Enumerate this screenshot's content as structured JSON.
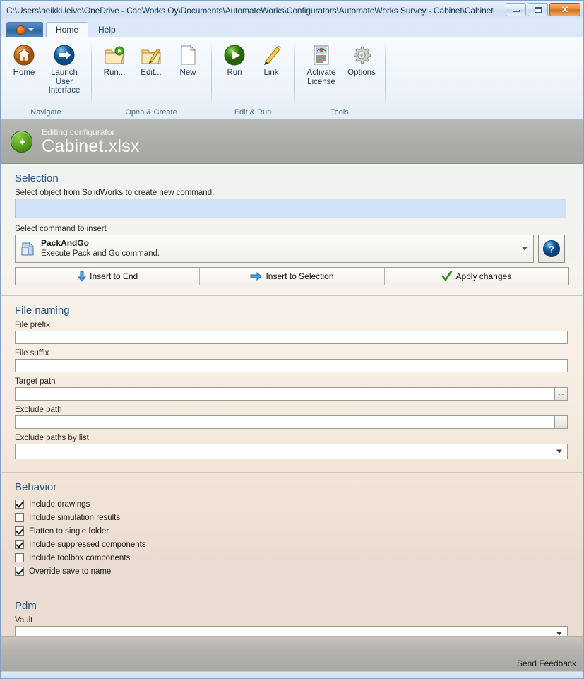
{
  "window": {
    "title": "C:\\Users\\heikki.leivo\\OneDrive - CadWorks Oy\\Documents\\AutomateWorks\\Configurators\\AutomateWorks Survey - Cabinet\\Cabinet.x",
    "minimize_label": "Minimize",
    "maximize_label": "Maximize",
    "close_label": "✕"
  },
  "tabs": [
    {
      "label": "Home",
      "active": true
    },
    {
      "label": "Help",
      "active": false
    }
  ],
  "ribbon": {
    "groups": [
      {
        "label": "Navigate",
        "items": [
          {
            "label": "Home",
            "icon": "home-circle-icon"
          },
          {
            "label": "Launch User Interface",
            "icon": "arrow-right-circle-icon"
          }
        ]
      },
      {
        "label": "Open & Create",
        "items": [
          {
            "label": "Run...",
            "icon": "folder-run-icon"
          },
          {
            "label": "Edit...",
            "icon": "folder-edit-icon"
          },
          {
            "label": "New",
            "icon": "new-document-icon"
          }
        ]
      },
      {
        "label": "Edit & Run",
        "items": [
          {
            "label": "Run",
            "icon": "play-circle-icon"
          },
          {
            "label": "Link",
            "icon": "pencil-icon"
          }
        ]
      },
      {
        "label": "Tools",
        "items": [
          {
            "label": "Activate License",
            "icon": "certificate-icon"
          },
          {
            "label": "Options",
            "icon": "gear-icon"
          }
        ]
      }
    ]
  },
  "page_header": {
    "subtitle": "Editing configurator",
    "title": "Cabinet.xlsx",
    "back_label": "Back"
  },
  "selection": {
    "title": "Selection",
    "hint": "Select object from SolidWorks to create new command.",
    "selected_object": "",
    "command_label": "Select command to insert",
    "command": {
      "name": "PackAndGo",
      "description": "Execute Pack and Go command."
    },
    "help_label": "?",
    "actions": [
      {
        "label": "Insert to End",
        "icon": "arrow-down-icon"
      },
      {
        "label": "Insert to Selection",
        "icon": "arrow-right-icon"
      },
      {
        "label": "Apply changes",
        "icon": "checkmark-icon"
      }
    ]
  },
  "file_naming": {
    "title": "File naming",
    "fields": [
      {
        "label": "File prefix",
        "value": "",
        "type": "text"
      },
      {
        "label": "File suffix",
        "value": "",
        "type": "text"
      },
      {
        "label": "Target path",
        "value": "",
        "type": "browse",
        "browse_label": "..."
      },
      {
        "label": "Exclude path",
        "value": "",
        "type": "browse",
        "browse_label": "..."
      },
      {
        "label": "Exclude paths by list",
        "value": "",
        "type": "combo"
      }
    ]
  },
  "behavior": {
    "title": "Behavior",
    "checkboxes": [
      {
        "label": "Include drawings",
        "checked": true
      },
      {
        "label": "Include simulation results",
        "checked": false
      },
      {
        "label": "Flatten to single folder",
        "checked": true
      },
      {
        "label": "Include suppressed components",
        "checked": true
      },
      {
        "label": "Include toolbox components",
        "checked": false
      },
      {
        "label": "Override save to name",
        "checked": true
      }
    ]
  },
  "pdm": {
    "title": "Pdm",
    "vault_label": "Vault",
    "vault_value": ""
  },
  "footer": {
    "send_feedback": "Send Feedback"
  },
  "colors": {
    "accent_heading": "#24547f",
    "selection_box": "#cfe1f3",
    "title_bar": "#dbe8f6",
    "header_band": "#aeaea9",
    "close_button": "#cf6f1c"
  }
}
